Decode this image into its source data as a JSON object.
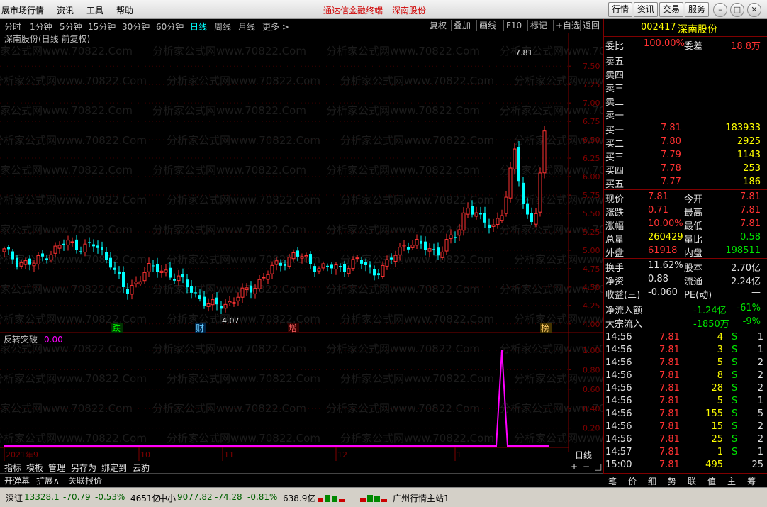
{
  "titlebar": {
    "menus": [
      "展市场行情",
      "资讯",
      "工具",
      "帮助"
    ],
    "product": "通达信金融终端",
    "stock_name": "深南股份",
    "buttons": [
      "行情",
      "资讯",
      "交易",
      "服务"
    ]
  },
  "periods": [
    "分时",
    "1分钟",
    "5分钟",
    "15分钟",
    "30分钟",
    "60分钟",
    "日线",
    "周线",
    "月线",
    "更多 >"
  ],
  "active_period": "日线",
  "chart_buttons": [
    "复权",
    "叠加",
    "画线",
    "F10",
    "标记",
    "+自选",
    "返回"
  ],
  "main_chart": {
    "label": "深南股份(日线 前复权)",
    "y_ticks": [
      "7.50",
      "7.25",
      "7.00",
      "6.75",
      "6.50",
      "6.25",
      "6.00",
      "5.75",
      "5.50",
      "5.25",
      "5.00",
      "4.75",
      "4.50",
      "4.25",
      "4.00"
    ],
    "high_label": "7.81",
    "low_label": "4.07",
    "markers": [
      "跌",
      "财",
      "增",
      "榜"
    ],
    "watermark": "分析家公式网www.70822.Com"
  },
  "sub_chart": {
    "label": "反转突破",
    "value": "0.00",
    "y_ticks": [
      "1.00",
      "0.80",
      "0.60",
      "0.40",
      "0.20"
    ]
  },
  "x_axis": {
    "labels": [
      "2021年9",
      "10",
      "11",
      "12",
      "1"
    ],
    "period": "日线"
  },
  "quote": {
    "code": "002417",
    "name": "深南股份",
    "webi_label": "委比",
    "webi": "100.00%",
    "weicha_label": "委差",
    "weicha": "18.8万",
    "sell": [
      {
        "label": "卖五"
      },
      {
        "label": "卖四"
      },
      {
        "label": "卖三"
      },
      {
        "label": "卖二"
      },
      {
        "label": "卖一"
      }
    ],
    "buy": [
      {
        "label": "买一",
        "price": "7.81",
        "vol": "183933"
      },
      {
        "label": "买二",
        "price": "7.80",
        "vol": "2925"
      },
      {
        "label": "买三",
        "price": "7.79",
        "vol": "1143"
      },
      {
        "label": "买四",
        "price": "7.78",
        "vol": "253"
      },
      {
        "label": "买五",
        "price": "7.77",
        "vol": "186"
      }
    ],
    "stats": [
      {
        "l1": "现价",
        "v1": "7.81",
        "l2": "今开",
        "v2": "7.81"
      },
      {
        "l1": "涨跌",
        "v1": "0.71",
        "l2": "最高",
        "v2": "7.81"
      },
      {
        "l1": "涨幅",
        "v1": "10.00%",
        "l2": "最低",
        "v2": "7.81"
      },
      {
        "l1": "总量",
        "v1": "260429",
        "l2": "量比",
        "v2": "0.58"
      },
      {
        "l1": "外盘",
        "v1": "61918",
        "l2": "内盘",
        "v2": "198511"
      }
    ],
    "stats2": [
      {
        "l1": "换手",
        "v1": "11.62%",
        "l2": "股本",
        "v2": "2.70亿"
      },
      {
        "l1": "净资",
        "v1": "0.88",
        "l2": "流通",
        "v2": "2.24亿"
      },
      {
        "l1": "收益(三)",
        "v1": "-0.060",
        "l2": "PE(动)",
        "v2": "—"
      }
    ],
    "flow": [
      {
        "label": "净流入额",
        "v1": "-1.24亿",
        "v2": "-61%"
      },
      {
        "label": "大宗流入",
        "v1": "-1850万",
        "v2": "-9%"
      }
    ],
    "ticks": [
      {
        "t": "14:56",
        "p": "7.81",
        "v": "4",
        "s": "S",
        "n": "1"
      },
      {
        "t": "14:56",
        "p": "7.81",
        "v": "3",
        "s": "S",
        "n": "1"
      },
      {
        "t": "14:56",
        "p": "7.81",
        "v": "5",
        "s": "S",
        "n": "2"
      },
      {
        "t": "14:56",
        "p": "7.81",
        "v": "8",
        "s": "S",
        "n": "2"
      },
      {
        "t": "14:56",
        "p": "7.81",
        "v": "28",
        "s": "S",
        "n": "2"
      },
      {
        "t": "14:56",
        "p": "7.81",
        "v": "5",
        "s": "S",
        "n": "1"
      },
      {
        "t": "14:56",
        "p": "7.81",
        "v": "155",
        "s": "S",
        "n": "5"
      },
      {
        "t": "14:56",
        "p": "7.81",
        "v": "15",
        "s": "S",
        "n": "2"
      },
      {
        "t": "14:56",
        "p": "7.81",
        "v": "25",
        "s": "S",
        "n": "2"
      },
      {
        "t": "14:57",
        "p": "7.81",
        "v": "1",
        "s": "S",
        "n": "1"
      },
      {
        "t": "15:00",
        "p": "7.81",
        "v": "495",
        "s": "",
        "n": "25"
      }
    ]
  },
  "bottom_tabs": [
    "指标",
    "模板",
    "管理",
    "另存为",
    "绑定到",
    "云豹"
  ],
  "bottom_tabs2": [
    "开弹幕",
    "扩展∧",
    "关联报价"
  ],
  "zoom_btns": [
    "+",
    "−",
    "□"
  ],
  "right_tabs": [
    "笔",
    "价",
    "细",
    "势",
    "联",
    "值",
    "主",
    "筹"
  ],
  "status": {
    "sz_label": "深证",
    "sz": "13328.1",
    "sz_chg": "-70.79",
    "sz_pct": "-0.53%",
    "sz_amt": "4651亿",
    "zx_label": "中小",
    "zx": "9077.82",
    "zx_chg": "-74.28",
    "zx_pct": "-0.81%",
    "zx_amt": "638.9亿",
    "server": "广州行情主站1"
  },
  "colors": {
    "up": "#ff3232",
    "down": "#00ffff",
    "grid": "#800000",
    "signal": "#ff00ff"
  }
}
